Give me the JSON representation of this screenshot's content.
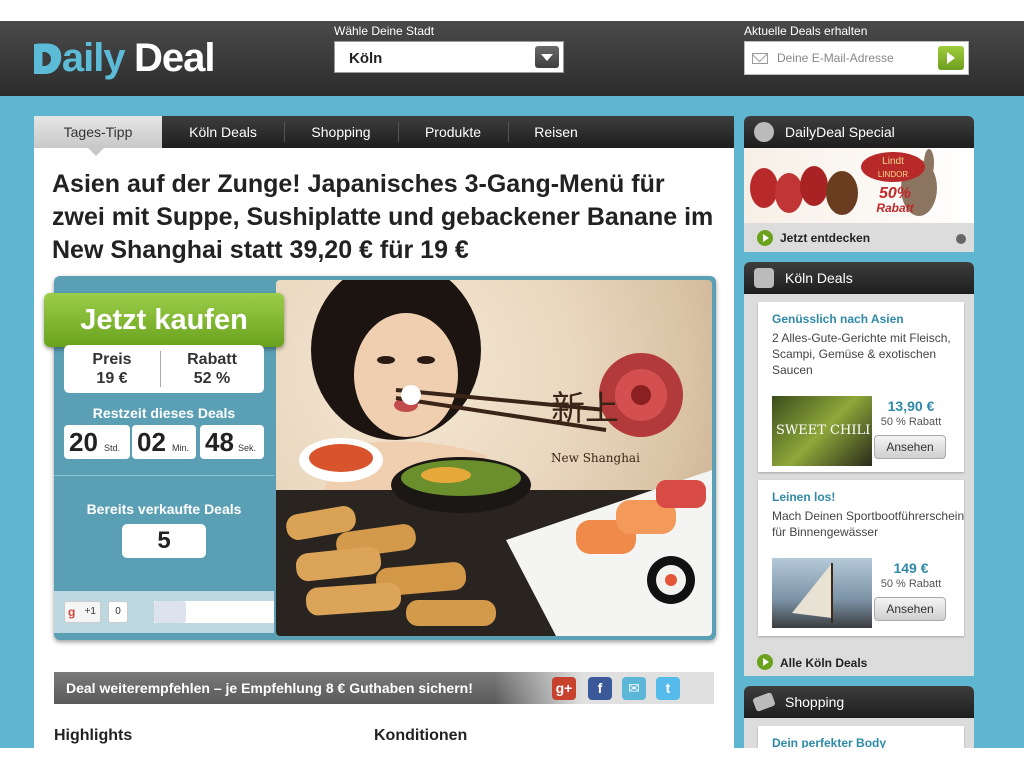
{
  "header": {
    "logo_daily": "Daily",
    "logo_deal": "Deal",
    "city_label": "Wähle Deine Stadt",
    "city_value": "Köln",
    "deals_label": "Aktuelle Deals erhalten",
    "email_placeholder": "Deine E-Mail-Adresse"
  },
  "tabs": [
    {
      "label": "Tages-Tipp"
    },
    {
      "label": "Köln Deals"
    },
    {
      "label": "Shopping"
    },
    {
      "label": "Produkte"
    },
    {
      "label": "Reisen"
    }
  ],
  "deal": {
    "headline": "Asien auf der Zunge! Japanisches 3-Gang-Menü für zwei mit Suppe, Sushiplatte und gebackener Banane im New Shanghai statt 39,20 € für 19 €",
    "buy_label": "Jetzt kaufen",
    "price_label": "Preis",
    "price_value": "19 €",
    "rabatt_label": "Rabatt",
    "rabatt_value": "52 %",
    "restzeit_label": "Restzeit dieses Deals",
    "hours": "20",
    "hours_unit": "Std.",
    "minutes": "02",
    "minutes_unit": "Min.",
    "seconds": "48",
    "seconds_unit": "Sek.",
    "sold_label": "Bereits verkaufte Deals",
    "sold_count": "5",
    "gplus_label": "+1",
    "gplus_count": "0",
    "photo_chars": "新上",
    "photo_brand": "New Shanghai"
  },
  "share": {
    "text": "Deal weiterempfehlen – je Empfehlung 8 € Guthaben sichern!",
    "icons": [
      "google-plus-icon",
      "facebook-icon",
      "email-icon",
      "twitter-icon"
    ]
  },
  "sections": {
    "highlights": "Highlights",
    "konditionen": "Konditionen"
  },
  "sidebar": {
    "special": {
      "title": "DailyDeal Special",
      "brand": "Lindt",
      "brand_sub": "LINDOR",
      "promo_pct": "50%",
      "promo_word": "Rabatt",
      "link": "Jetzt entdecken"
    },
    "koeln": {
      "title": "Köln Deals",
      "cards": [
        {
          "title": "Genüsslich nach Asien",
          "desc": "2 Alles-Gute-Gerichte mit Fleisch, Scampi, Gemüse & exotischen Saucen",
          "img_text": "SWEET CHILI",
          "price": "13,90 €",
          "rabatt": "50 % Rabatt",
          "button": "Ansehen"
        },
        {
          "title": "Leinen los!",
          "desc": "Mach Deinen Sportbootführerschein für Binnengewässer",
          "price": "149 €",
          "rabatt": "50 % Rabatt",
          "button": "Ansehen"
        }
      ],
      "all_link": "Alle Köln Deals"
    },
    "shopping": {
      "title": "Shopping",
      "card_title": "Dein perfekter Body"
    }
  },
  "colors": {
    "brand_blue": "#5cbcd8",
    "page_bg": "#5eb6d0",
    "buy_green": "#7cb52c",
    "link_blue": "#2f8aa8"
  }
}
